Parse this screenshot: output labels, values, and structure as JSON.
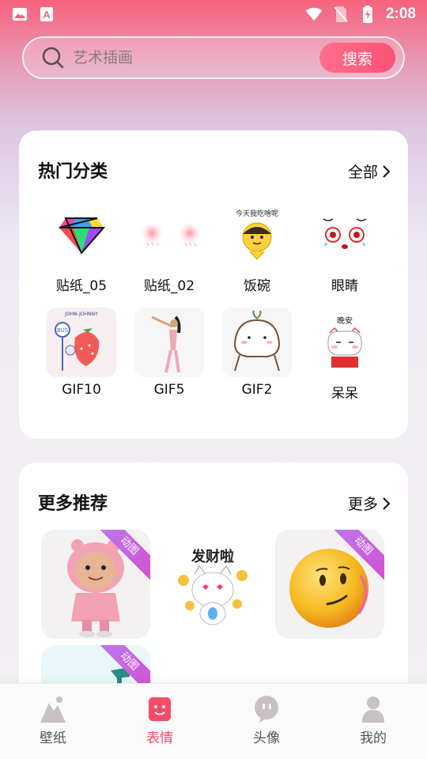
{
  "status_bar": {
    "time": "2:08"
  },
  "search": {
    "placeholder": "艺术插画",
    "button": "搜索"
  },
  "hot": {
    "title": "热门分类",
    "link": "全部",
    "items": [
      {
        "label": "贴纸_05",
        "icon": "diamond-sticker"
      },
      {
        "label": "贴纸_02",
        "icon": "blush-sticker"
      },
      {
        "label": "饭碗",
        "icon": "rice-bowl-sticker",
        "caption": "今天我吃啥呢"
      },
      {
        "label": "眼睛",
        "icon": "eyes-sticker"
      },
      {
        "label": "GIF10",
        "icon": "strawberry-bus-gif",
        "caption_top": "JOHN-JOHNNY",
        "caption_sign": "BUS"
      },
      {
        "label": "GIF5",
        "icon": "dancer-gif"
      },
      {
        "label": "GIF2",
        "icon": "bun-character-gif"
      },
      {
        "label": "呆呆",
        "icon": "sleepy-cat-sticker",
        "caption": "晚安"
      }
    ]
  },
  "more": {
    "title": "更多推荐",
    "link": "更多",
    "badge": "动图",
    "items": [
      {
        "icon": "pink-hoodie-character",
        "animated": true
      },
      {
        "icon": "fortune-cat",
        "caption": "发财啦",
        "animated": false
      },
      {
        "icon": "smirk-emoji",
        "animated": true
      },
      {
        "icon": "teal-partial",
        "animated": true
      }
    ]
  },
  "tabs": [
    {
      "label": "壁纸",
      "icon": "mountain-icon",
      "active": false
    },
    {
      "label": "表情",
      "icon": "smile-icon",
      "active": true
    },
    {
      "label": "头像",
      "icon": "chat-face-icon",
      "active": false
    },
    {
      "label": "我的",
      "icon": "person-icon",
      "active": false
    }
  ],
  "colors": {
    "accent": "#fa4a6a",
    "badge": "#c865e0",
    "header_top": "#f7627c"
  }
}
